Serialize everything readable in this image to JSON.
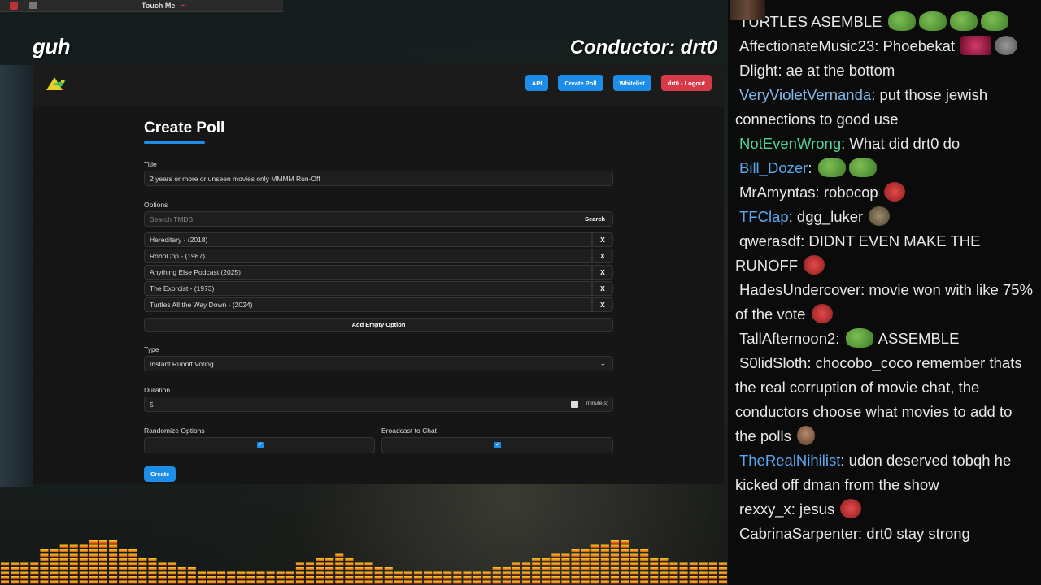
{
  "overlay": {
    "window_title": "Touch Me",
    "stream_name": "guh",
    "conductor": "Conductor: drt0"
  },
  "nav": {
    "api": "API",
    "create_poll": "Create Poll",
    "whitelist": "Whitelist",
    "logout": "drt0 - Logout"
  },
  "form": {
    "page_title": "Create Poll",
    "title_label": "Title",
    "title_value": "2 years or more or unseen movies only MMMM Run-Off",
    "options_label": "Options",
    "search_placeholder": "Search TMDB",
    "search_button": "Search",
    "options": [
      {
        "label": "Hereditary - (2018)",
        "remove": "X"
      },
      {
        "label": "RoboCop - (1987)",
        "remove": "X"
      },
      {
        "label": "Anything Else Podcast (2025)",
        "remove": "X"
      },
      {
        "label": "The Exorcist - (1973)",
        "remove": "X"
      },
      {
        "label": "Turtles All the Way Down - (2024)",
        "remove": "X"
      }
    ],
    "add_empty_option": "Add Empty Option",
    "type_label": "Type",
    "type_value": "Instant Runoff Voting",
    "duration_label": "Duration",
    "duration_value": "5",
    "duration_unit": "minute(s)",
    "randomize_label": "Randomize Options",
    "randomize_checked": true,
    "broadcast_label": "Broadcast to Chat",
    "broadcast_checked": true,
    "create_button": "Create"
  },
  "colors": {
    "accent": "#1e8de8",
    "logout": "#d93a4a"
  },
  "chat": [
    {
      "user": "",
      "user_color": "#e8e8e8",
      "text": "TURTLES ASEMBLE",
      "emotes": [
        "pepe",
        "pepe",
        "pepe",
        "pepe"
      ]
    },
    {
      "user": "AffectionateMusic23",
      "user_color": "#e8e8e8",
      "text": ": Phoebekat",
      "emotes": [
        "pink",
        "gray"
      ]
    },
    {
      "user": "Dlight",
      "user_color": "#e8e8e8",
      "text": ": ae at the bottom",
      "emotes": [
        "scene"
      ]
    },
    {
      "user": "VeryVioletVernanda",
      "user_color": "#7fb8ea",
      "text": ": put those jewish connections to good use",
      "emotes": []
    },
    {
      "user": "NotEvenWrong",
      "user_color": "#4fd39a",
      "text": ": What did drt0 do",
      "emotes": []
    },
    {
      "user": "Bill_Dozer",
      "user_color": "#5aa8f0",
      "text": ":",
      "emotes": [
        "pepe",
        "pepe"
      ]
    },
    {
      "user": "MrAmyntas",
      "user_color": "#e8e8e8",
      "text": ": robocop",
      "emotes": [
        "red"
      ]
    },
    {
      "user": "TFClap",
      "user_color": "#5aa8f0",
      "text": ": dgg_luker",
      "emotes": [
        "soldier"
      ]
    },
    {
      "user": "qwerasdf",
      "user_color": "#e8e8e8",
      "text": ": DIDNT EVEN MAKE THE RUNOFF",
      "emotes": [
        "red"
      ]
    },
    {
      "user": "HadesUndercover",
      "user_color": "#e8e8e8",
      "text": ": movie won with like 75% of the vote",
      "emotes": [
        "red"
      ]
    },
    {
      "user": "TallAfternoon2",
      "user_color": "#e8e8e8",
      "text": ":",
      "emotes": [
        "pepe"
      ],
      "after": "ASSEMBLE"
    },
    {
      "user": "S0lidSloth",
      "user_color": "#e8e8e8",
      "text": ": chocobo_coco remember thats the real corruption of movie chat, the conductors choose what movies to add to the polls",
      "emotes": [
        "face"
      ]
    },
    {
      "user": "TheRealNihilist",
      "user_color": "#5aa8f0",
      "text": ": udon deserved tobqh he kicked off dman from the show",
      "emotes": []
    },
    {
      "user": "rexxy_x",
      "user_color": "#e8e8e8",
      "text": ": jesus",
      "emotes": [
        "red"
      ]
    },
    {
      "user": "CabrinaSarpenter",
      "user_color": "#e8e8e8",
      "text": ": drt0 stay strong",
      "emotes": []
    }
  ]
}
